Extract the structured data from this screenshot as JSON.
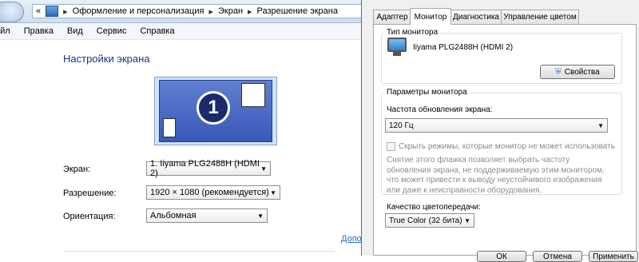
{
  "breadcrumb": {
    "nav_prefix": "«",
    "items": [
      "Оформление и персонализация",
      "Экран",
      "Разрешение экрана"
    ],
    "separator": "▸"
  },
  "menu": {
    "items": [
      "айл",
      "Правка",
      "Вид",
      "Сервис",
      "Справка"
    ]
  },
  "display_settings": {
    "title": "Настройки экрана",
    "monitor_number": "1",
    "screen_label": "Экран:",
    "screen_value": "1. Iiyama PLG2488H (HDMI 2)",
    "resolution_label": "Разрешение:",
    "resolution_value": "1920 × 1080 (рекомендуется)",
    "orientation_label": "Ориентация:",
    "orientation_value": "Альбомная",
    "advanced_link": "Допо"
  },
  "dialog": {
    "tabs": [
      "Адаптер",
      "Монитор",
      "Диагностика",
      "Управление цветом"
    ],
    "active_tab": "Монитор",
    "monitor_type_group": "Тип монитора",
    "monitor_name": "Iiyama PLG2488H (HDMI 2)",
    "properties_button": "Свойства",
    "monitor_params_group": "Параметры монитора",
    "refresh_label": "Частота обновления экрана:",
    "refresh_value": "120 Гц",
    "hide_modes_label": "Скрыть режимы, которые монитор не может использовать",
    "hint_text": "Снятие этого флажка позволяет выбрать частоту обновления экрана, не поддерживаемую этим монитором, что может привести к выводу неустойчивого изображения или даже к неисправности оборудования.",
    "color_quality_label": "Качество цветопередачи:",
    "color_quality_value": "True Color (32 бита)",
    "bottom_buttons": [
      "ОК",
      "Отмена",
      "Применить"
    ]
  },
  "colors": {
    "title_blue": "#1e3287",
    "link_blue": "#2a6ac9",
    "monitor_blue": "#3a58b8"
  }
}
